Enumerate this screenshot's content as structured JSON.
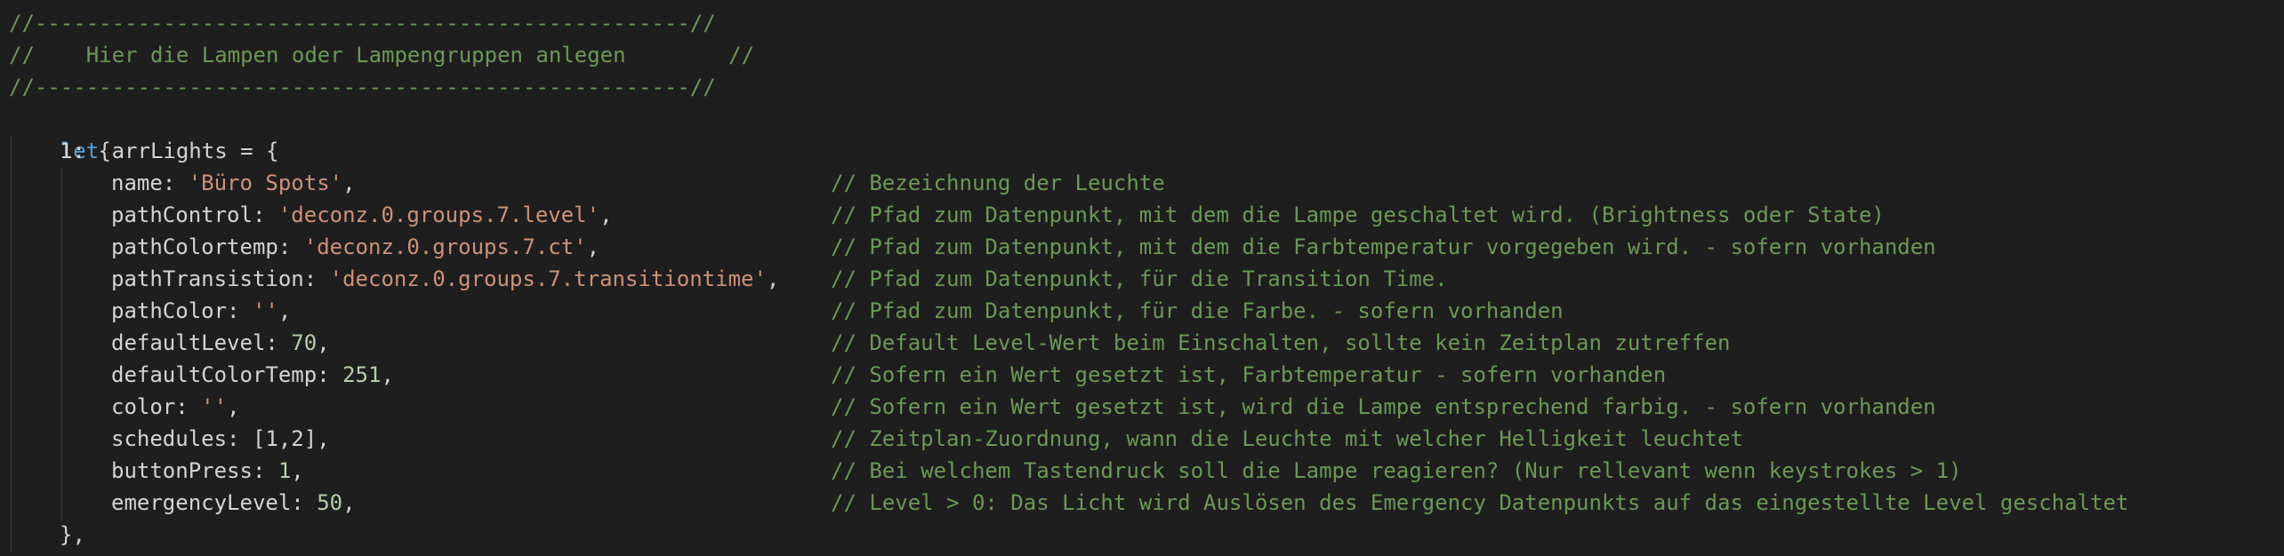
{
  "header": {
    "line1": "//---------------------------------------------------//",
    "line2": "//    Hier die Lampen oder Lampengruppen anlegen        //",
    "line3": "//---------------------------------------------------//"
  },
  "declaration": {
    "keyword": "let",
    "rest": " arrLights = {"
  },
  "object_open": "1: {",
  "object_close": "},",
  "properties": [
    {
      "key": "name: ",
      "value": "'Büro Spots'",
      "value_type": "str",
      "tail": ",",
      "comment": "// Bezeichnung der Leuchte"
    },
    {
      "key": "pathControl: ",
      "value": "'deconz.0.groups.7.level'",
      "value_type": "str",
      "tail": ",",
      "comment": "// Pfad zum Datenpunkt, mit dem die Lampe geschaltet wird. (Brightness oder State)"
    },
    {
      "key": "pathColortemp: ",
      "value": "'deconz.0.groups.7.ct'",
      "value_type": "str",
      "tail": ",",
      "comment": "// Pfad zum Datenpunkt, mit dem die Farbtemperatur vorgegeben wird. - sofern vorhanden"
    },
    {
      "key": "pathTransistion: ",
      "value": "'deconz.0.groups.7.transitiontime'",
      "value_type": "str",
      "tail": ",",
      "comment": "// Pfad zum Datenpunkt, für die Transition Time."
    },
    {
      "key": "pathColor: ",
      "value": "''",
      "value_type": "str",
      "tail": ",",
      "comment": "// Pfad zum Datenpunkt, für die Farbe. - sofern vorhanden"
    },
    {
      "key": "defaultLevel: ",
      "value": "70",
      "value_type": "num",
      "tail": ",",
      "comment": "// Default Level-Wert beim Einschalten, sollte kein Zeitplan zutreffen"
    },
    {
      "key": "defaultColorTemp: ",
      "value": "251",
      "value_type": "num",
      "tail": ",",
      "comment": "// Sofern ein Wert gesetzt ist, Farbtemperatur - sofern vorhanden"
    },
    {
      "key": "color: ",
      "value": "''",
      "value_type": "str",
      "tail": ",",
      "comment": "// Sofern ein Wert gesetzt ist, wird die Lampe entsprechend farbig. - sofern vorhanden"
    },
    {
      "key": "schedules: ",
      "value": "[1,2]",
      "value_type": "txt",
      "tail": ",",
      "comment": "// Zeitplan-Zuordnung, wann die Leuchte mit welcher Helligkeit leuchtet"
    },
    {
      "key": "buttonPress: ",
      "value": "1",
      "value_type": "num",
      "tail": ",",
      "comment": "// Bei welchem Tastendruck soll die Lampe reagieren? (Nur rellevant wenn keystrokes > 1)"
    },
    {
      "key": "emergencyLevel: ",
      "value": "50",
      "value_type": "num",
      "tail": ",",
      "comment": "// Level > 0: Das Licht wird Auslösen des Emergency Datenpunkts auf das eingestellte Level geschaltet"
    }
  ]
}
